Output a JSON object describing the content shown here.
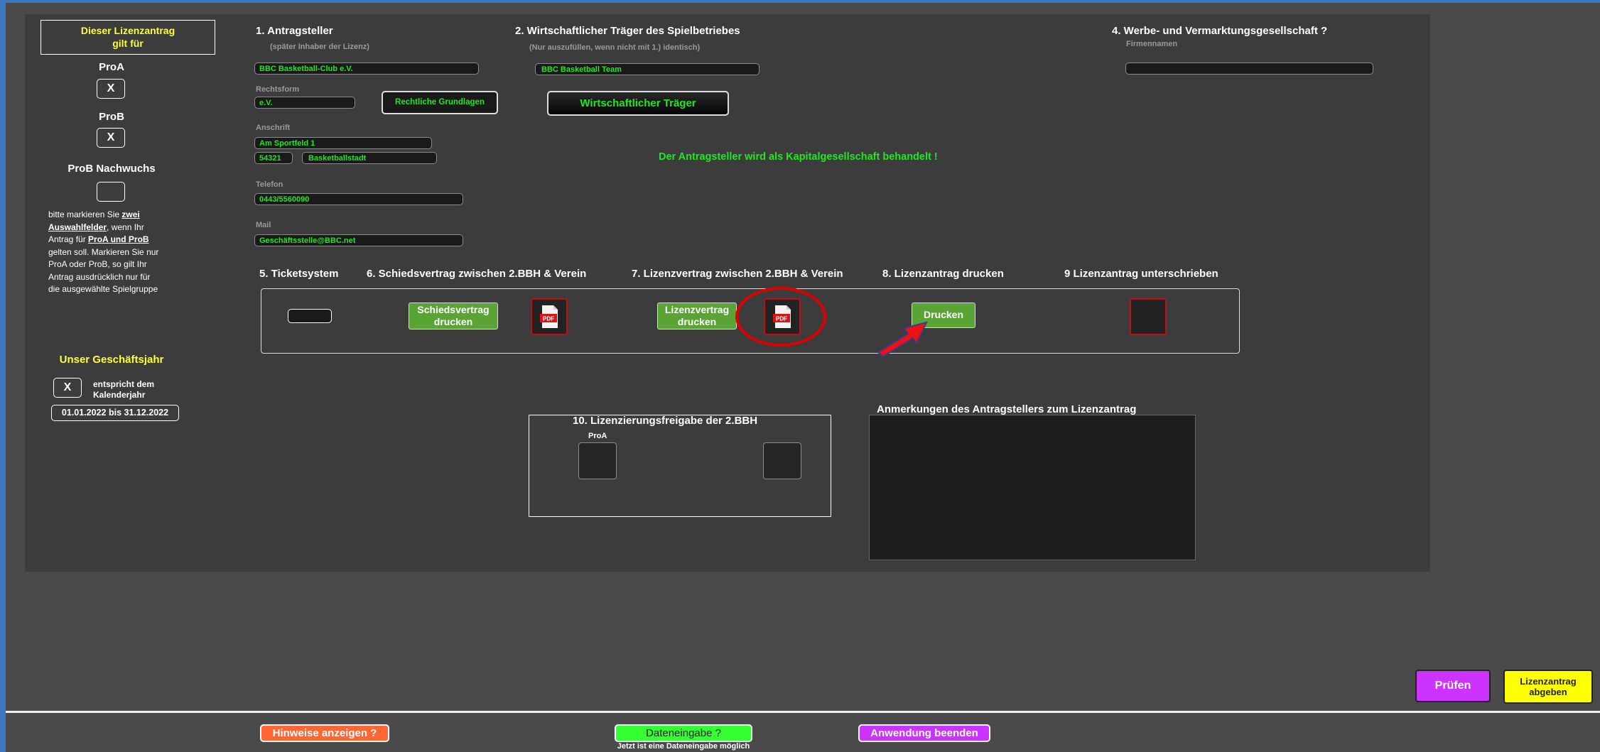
{
  "sidebar": {
    "license_box_line1": "Dieser Lizenzantrag",
    "license_box_line2": "gilt für",
    "proa_label": "ProA",
    "proa_value": "X",
    "prob_label": "ProB",
    "prob_value": "X",
    "prob_nachwuchs_label": "ProB Nachwuchs",
    "prob_nachwuchs_value": "",
    "hint": {
      "l1a": "bitte markieren Sie ",
      "l1b": "zwei",
      "l2a": "Auswahlfelder",
      "l2b": ", wenn Ihr",
      "l3a": "Antrag für ",
      "l3b": "ProA und ProB",
      "l4": "gelten soll. Markieren Sie nur",
      "l5": "ProA oder ProB, so gilt Ihr",
      "l6": "Antrag ausdrücklich nur für",
      "l7": "die ausgewählte Spielgruppe"
    },
    "fiscal_title": "Unser Geschäftsjahr",
    "fiscal_check": "X",
    "fiscal_line1": "entspricht dem",
    "fiscal_line2": "Kalenderjahr",
    "fiscal_period": "01.01.2022 bis 31.12.2022"
  },
  "applicant": {
    "title": "1.  Antragsteller",
    "subtitle": "(später Inhaber der Lizenz)",
    "name": "BBC Basketball-Club e.V.",
    "rechtsform_label": "Rechtsform",
    "rechtsform": "e.V.",
    "legal_button": "Rechtliche Grundlagen",
    "address_label": "Anschrift",
    "street": "Am Sportfeld 1",
    "zip": "54321",
    "city": "Basketballstadt",
    "phone_label": "Telefon",
    "phone": "0443/5560090",
    "mail_label": "Mail",
    "mail": "Geschäftsstelle@BBC.net"
  },
  "operator": {
    "title": "2.  Wirtschaftlicher Träger des Spielbetriebes",
    "subtitle": "(Nur auszufüllen, wenn nicht mit 1.) identisch)",
    "name": "BBC Basketball Team",
    "button": "Wirtschaftlicher Träger",
    "notice": "Der Antragsteller wird als Kapitalgesellschaft behandelt !"
  },
  "marketing": {
    "title": "4.  Werbe- und Vermarktungsgesellschaft ?",
    "subtitle": "Firmennamen",
    "value": ""
  },
  "steps": {
    "s5": "5.  Ticketsystem",
    "s6": "6.  Schiedsvertrag zwischen 2.BBH & Verein",
    "s7": "7.  Lizenzvertrag zwischen 2.BBH & Verein",
    "s8": "8.  Lizenzantrag drucken",
    "s9": "9  Lizenzantrag unterschrieben",
    "schieds_btn_l1": "Schiedsvertrag",
    "schieds_btn_l2": "drucken",
    "lizenz_btn_l1": "Lizenzvertrag",
    "lizenz_btn_l2": "drucken",
    "drucken_btn": "Drucken",
    "pdf_label": "PDF"
  },
  "release": {
    "title": "10.  Lizenzierungsfreigabe der 2.BBH",
    "proa_label": "ProA"
  },
  "remarks": {
    "title": "Anmerkungen des Antragstellers zum Lizenzantrag"
  },
  "actions": {
    "pruefen": "Prüfen",
    "abgeben_l1": "Lizenzantrag",
    "abgeben_l2": "abgeben"
  },
  "footer": {
    "hinweise": "Hinweise anzeigen ?",
    "dateneingabe": "Dateneingabe ?",
    "dateneingabe_note": "Jetzt ist eine Dateneingabe möglich",
    "beenden": "Anwendung beenden"
  },
  "colors": {
    "field_text": "#22e622",
    "accent_yellow": "#ffff33",
    "button_green": "#5aa436",
    "purple": "#cc33ff",
    "orange": "#ff6633",
    "bright_green": "#33ff33",
    "highlight_red": "#e00000"
  }
}
